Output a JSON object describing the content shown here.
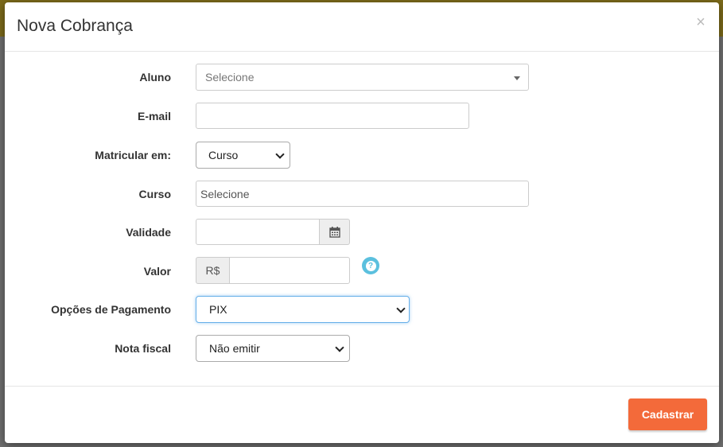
{
  "modal": {
    "title": "Nova Cobrança",
    "close_label": "×"
  },
  "form": {
    "aluno": {
      "label": "Aluno",
      "value": "Selecione"
    },
    "email": {
      "label": "E-mail",
      "value": ""
    },
    "matricular": {
      "label": "Matricular em:",
      "value": "Curso"
    },
    "curso": {
      "label": "Curso",
      "value": "Selecione"
    },
    "validade": {
      "label": "Validade",
      "value": ""
    },
    "valor": {
      "label": "Valor",
      "prefix": "R$",
      "value": "",
      "help_symbol": "?"
    },
    "pagamento": {
      "label": "Opções de Pagamento",
      "value": "PIX"
    },
    "nota": {
      "label": "Nota fiscal",
      "value": "Não emitir"
    }
  },
  "footer": {
    "submit_label": "Cadastrar"
  },
  "colors": {
    "accent": "#f36a3a",
    "info": "#5bc0de",
    "focus_border": "#66afe9"
  },
  "icons": {
    "calendar": "calendar-icon",
    "help": "question-circle-icon"
  }
}
